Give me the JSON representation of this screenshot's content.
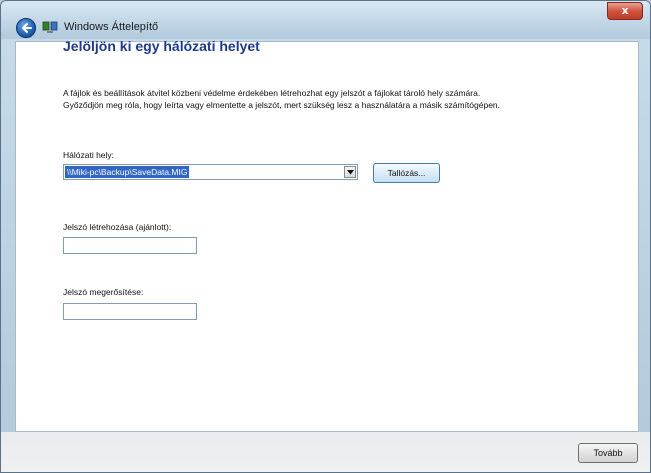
{
  "window": {
    "title": "Windows Áttelepítő",
    "close_label": "x"
  },
  "page": {
    "heading": "Jelöljön ki egy hálózati helyet",
    "description_line1": "A fájlok és beállítások átvitel közbeni védelme érdekében létrehozhat egy jelszót a fájlokat tároló hely számára.",
    "description_line2": "Győződjön meg róla, hogy leírta vagy elmentette a jelszót, mert szükség lesz a használatára a másik számítógépen."
  },
  "form": {
    "network_location_label": "Hálózati hely:",
    "network_location_value": "\\\\Miki-pc\\Backup\\SaveData.MIG",
    "browse_label": "Tallózás...",
    "password_label": "Jelszó létrehozása (ajánlott):",
    "password_value": "",
    "confirm_label": "Jelszó megerősítése:",
    "confirm_value": ""
  },
  "footer": {
    "next_label": "Tovább"
  },
  "icons": {
    "back": "back-arrow-icon",
    "app": "windows-easy-transfer-icon",
    "dropdown": "chevron-down-icon",
    "close": "close-icon"
  },
  "colors": {
    "heading": "#1e3a8c",
    "selection": "#3166c5",
    "close_button": "#c13a26"
  }
}
